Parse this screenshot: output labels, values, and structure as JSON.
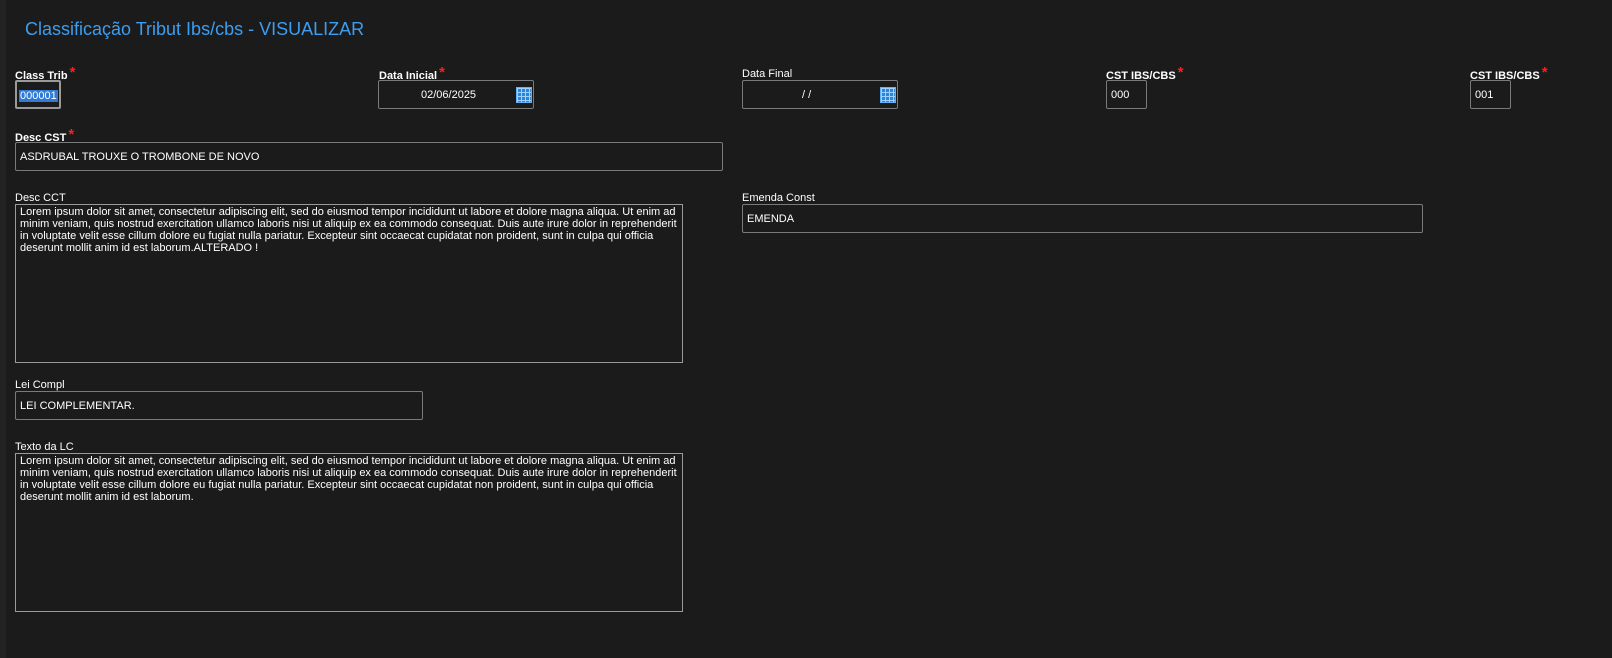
{
  "page": {
    "title": "Classificação Tribut Ibs/cbs - VISUALIZAR"
  },
  "fields": {
    "class_trib": {
      "label": "Class Trib",
      "value": "000001"
    },
    "data_inicial": {
      "label": "Data Inicial",
      "value": "02/06/2025"
    },
    "data_final": {
      "label": "Data Final",
      "value": "/  /"
    },
    "cst_ibs_cbs_1": {
      "label": "CST IBS/CBS",
      "value": "000"
    },
    "cst_ibs_cbs_2": {
      "label": "CST IBS/CBS",
      "value": "001"
    },
    "desc_cst": {
      "label": "Desc CST",
      "value": "ASDRUBAL TROUXE O TROMBONE DE NOVO"
    },
    "desc_cct": {
      "label": "Desc CCT",
      "value": "Lorem ipsum dolor sit amet, consectetur adipiscing elit, sed do eiusmod tempor incididunt ut labore et dolore magna aliqua. Ut enim ad minim veniam, quis nostrud exercitation ullamco laboris nisi ut aliquip ex ea commodo consequat. Duis aute irure dolor in reprehenderit in voluptate velit esse cillum dolore eu fugiat nulla pariatur. Excepteur sint occaecat cupidatat non proident, sunt in culpa qui officia deserunt mollit anim id est laborum.ALTERADO !"
    },
    "emenda_const": {
      "label": "Emenda Const",
      "value": "EMENDA"
    },
    "lei_compl": {
      "label": "Lei Compl",
      "value": "LEI COMPLEMENTAR."
    },
    "texto_lc": {
      "label": "Texto da LC",
      "value": "Lorem ipsum dolor sit amet, consectetur adipiscing elit, sed do eiusmod tempor incididunt ut labore et dolore magna aliqua. Ut enim ad minim veniam, quis nostrud exercitation ullamco laboris nisi ut aliquip ex ea commodo consequat. Duis aute irure dolor in reprehenderit in voluptate velit esse cillum dolore eu fugiat nulla pariatur. Excepteur sint occaecat cupidatat non proident, sunt in culpa qui officia deserunt mollit anim id est laborum."
    }
  },
  "required_marker": "*",
  "icons": {
    "calendar": "calendar-icon"
  },
  "colors": {
    "title": "#3d9df0",
    "required": "#ff1e1e",
    "background": "#1b1b1b",
    "border": "#7a7a7a",
    "selection": "#2f7bd6"
  }
}
